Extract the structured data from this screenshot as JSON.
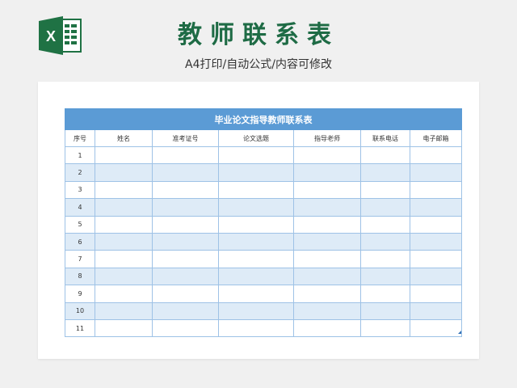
{
  "header": {
    "title": "教师联系表",
    "subtitle": "A4打印/自动公式/内容可修改",
    "logo_letter": "X"
  },
  "table": {
    "caption": "毕业论文指导教师联系表",
    "columns": [
      "序号",
      "姓名",
      "准考证号",
      "论文选题",
      "指导老师",
      "联系电话",
      "电子邮箱"
    ],
    "rows": [
      "1",
      "2",
      "3",
      "4",
      "5",
      "6",
      "7",
      "8",
      "9",
      "10",
      "11"
    ]
  },
  "colors": {
    "title_green": "#1e6b45",
    "excel_green": "#1f7244",
    "caption_blue": "#5b9bd5",
    "stripe_blue": "#deebf7",
    "border_blue": "#9ec2e6"
  }
}
